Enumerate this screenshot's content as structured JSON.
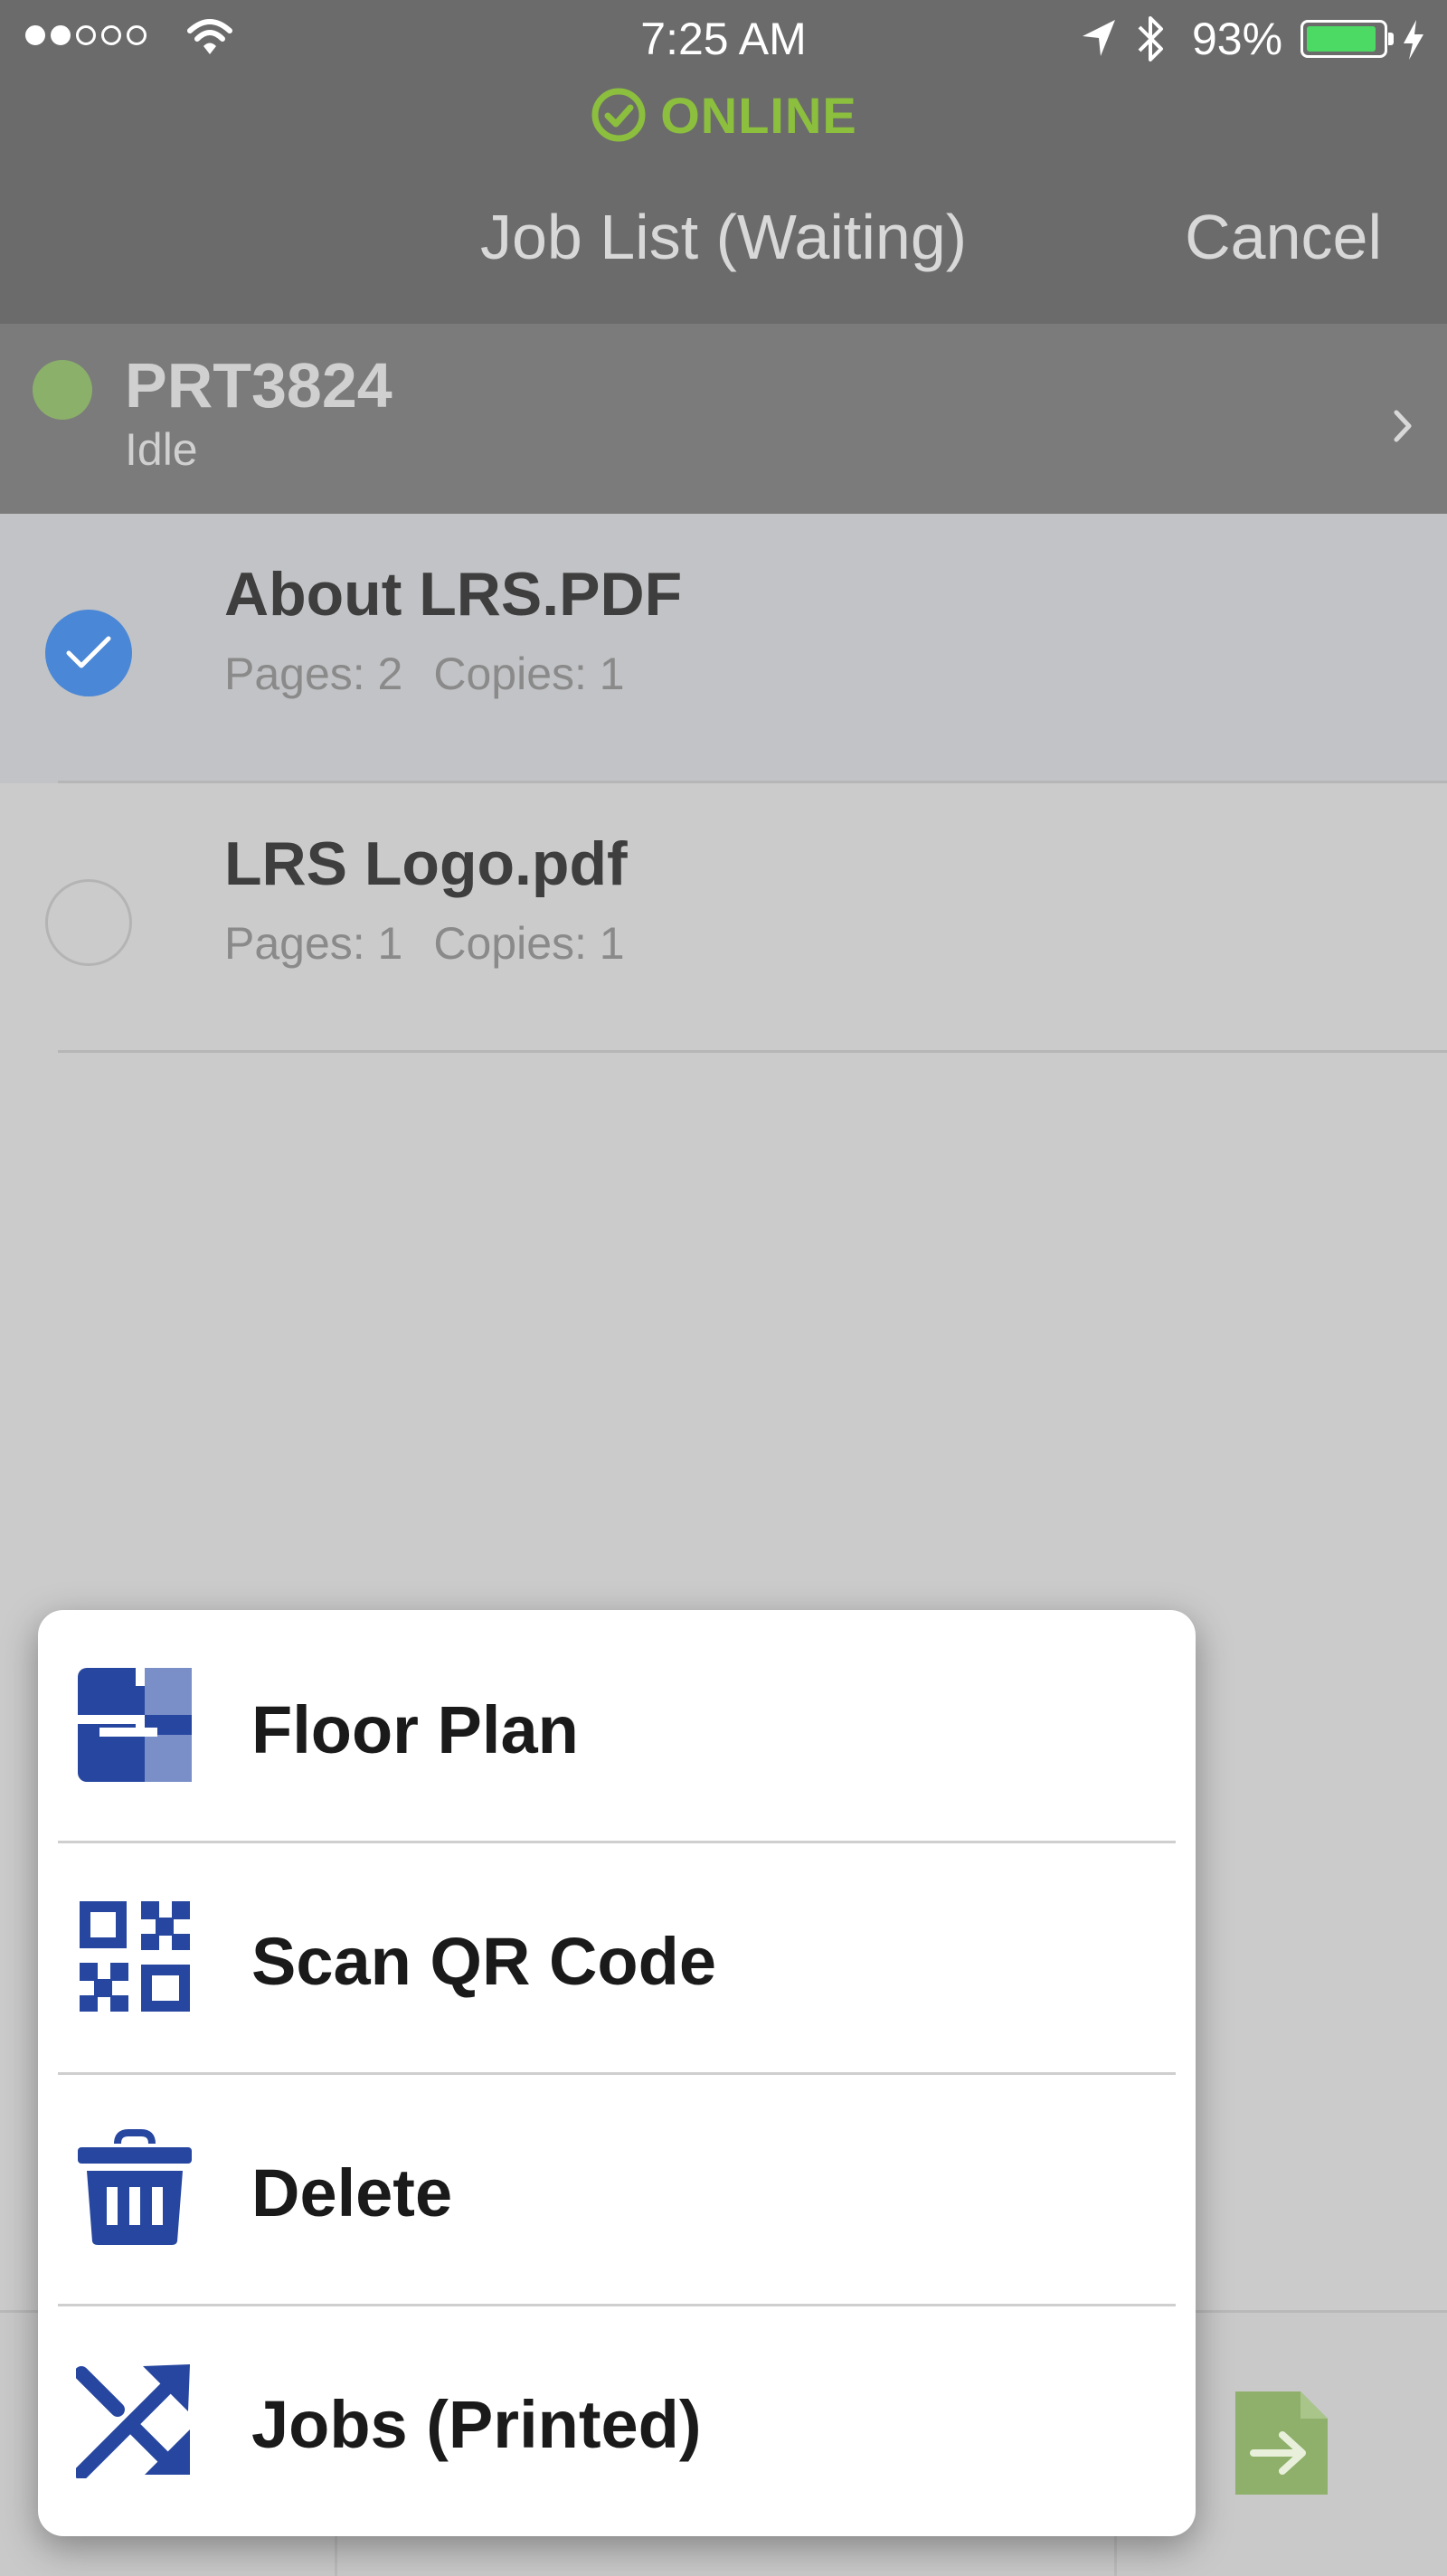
{
  "status_bar": {
    "time": "7:25 AM",
    "battery_percent": "93%",
    "battery_level": 0.93,
    "signal_bars": 2,
    "signal_total": 5
  },
  "online_banner": {
    "text": "ONLINE",
    "color": "#8bbf3d"
  },
  "nav": {
    "title": "Job List (Waiting)",
    "cancel_label": "Cancel"
  },
  "printer": {
    "name": "PRT3824",
    "status": "Idle"
  },
  "jobs": [
    {
      "name": "About LRS.PDF",
      "pages": "Pages: 2",
      "copies": "Copies: 1",
      "selected": true
    },
    {
      "name": "LRS Logo.pdf",
      "pages": "Pages: 1",
      "copies": "Copies: 1",
      "selected": false
    }
  ],
  "menu": {
    "items": [
      {
        "label": "Floor Plan",
        "icon": "floor-plan-icon"
      },
      {
        "label": "Scan QR Code",
        "icon": "qr-code-icon"
      },
      {
        "label": "Delete",
        "icon": "trash-icon"
      },
      {
        "label": "Jobs (Printed)",
        "icon": "shuffle-icon"
      }
    ]
  },
  "colors": {
    "accent_blue": "#2646a0",
    "check_blue": "#4a87d6",
    "online_green": "#8bbf3d"
  }
}
